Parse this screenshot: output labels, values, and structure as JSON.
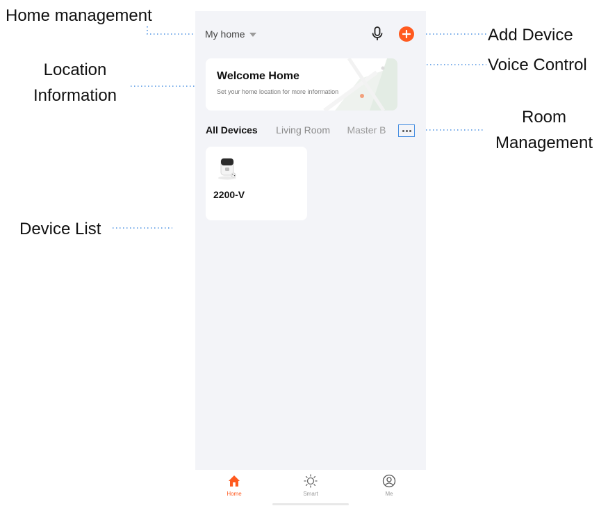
{
  "annotations": {
    "home_management": "Home management",
    "location_info_line1": "Location",
    "location_info_line2": "Information",
    "add_device": "Add Device",
    "voice_control": "Voice Control",
    "room_management_line1": "Room",
    "room_management_line2": "Management",
    "device_list": "Device List"
  },
  "header": {
    "home_name": "My home"
  },
  "welcome": {
    "title": "Welcome Home",
    "subtitle": "Set your home location for more information"
  },
  "rooms": {
    "tabs": [
      "All Devices",
      "Living Room",
      "Master B"
    ],
    "active": "All Devices"
  },
  "devices": [
    {
      "name": "2200-V"
    }
  ],
  "tabbar": {
    "items": [
      {
        "label": "Home",
        "icon": "home-icon",
        "active": true
      },
      {
        "label": "Smart",
        "icon": "sun-icon",
        "active": false
      },
      {
        "label": "Me",
        "icon": "user-icon",
        "active": false
      }
    ]
  },
  "colors": {
    "accent": "#ff5a1f",
    "annotation_line": "#4a90e2",
    "phone_background": "#f3f4f8"
  }
}
